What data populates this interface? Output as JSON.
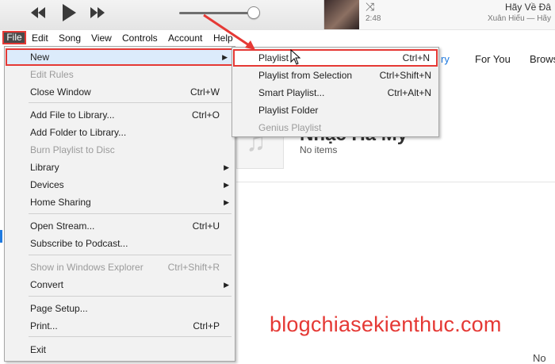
{
  "player": {
    "prev_icon": "rewind-icon",
    "play_icon": "play-icon",
    "next_icon": "fast-forward-icon",
    "volume_level": 0.9,
    "now_playing": {
      "title": "Hãy Về Đâ",
      "time": "2:48",
      "artist": "Xuân Hiếu — Hãy",
      "shuffle_icon": "shuffle-icon"
    }
  },
  "menubar": [
    "File",
    "Edit",
    "Song",
    "View",
    "Controls",
    "Account",
    "Help"
  ],
  "background": {
    "tab_partial": "ry",
    "tab_for_you": "For You",
    "tab_browse": "Brows",
    "playlist_title": "Nhạc Hà My",
    "playlist_sub": "No items",
    "corner_text": "No"
  },
  "file_menu": {
    "items": [
      {
        "label": "New",
        "shortcut": "",
        "submenu": true
      },
      {
        "label": "Edit Rules",
        "shortcut": "",
        "disabled": true
      },
      {
        "label": "Close Window",
        "shortcut": "Ctrl+W"
      },
      {
        "label": "Add File to Library...",
        "shortcut": "Ctrl+O"
      },
      {
        "label": "Add Folder to Library...",
        "shortcut": ""
      },
      {
        "label": "Burn Playlist to Disc",
        "shortcut": "",
        "disabled": true
      },
      {
        "label": "Library",
        "shortcut": "",
        "submenu": true
      },
      {
        "label": "Devices",
        "shortcut": "",
        "submenu": true
      },
      {
        "label": "Home Sharing",
        "shortcut": "",
        "submenu": true
      },
      {
        "label": "Open Stream...",
        "shortcut": "Ctrl+U"
      },
      {
        "label": "Subscribe to Podcast...",
        "shortcut": ""
      },
      {
        "label": "Show in Windows Explorer",
        "shortcut": "Ctrl+Shift+R",
        "disabled": true
      },
      {
        "label": "Convert",
        "shortcut": "",
        "submenu": true
      },
      {
        "label": "Page Setup...",
        "shortcut": ""
      },
      {
        "label": "Print...",
        "shortcut": "Ctrl+P"
      },
      {
        "label": "Exit",
        "shortcut": ""
      }
    ]
  },
  "new_submenu": {
    "items": [
      {
        "label": "Playlist",
        "shortcut": "Ctrl+N"
      },
      {
        "label": "Playlist from Selection",
        "shortcut": "Ctrl+Shift+N"
      },
      {
        "label": "Smart Playlist...",
        "shortcut": "Ctrl+Alt+N"
      },
      {
        "label": "Playlist Folder",
        "shortcut": ""
      },
      {
        "label": "Genius Playlist",
        "shortcut": "",
        "disabled": true
      }
    ]
  },
  "watermark": "blogchiasekienthuc.com",
  "colors": {
    "highlight_border": "#e53935",
    "accent": "#1f7ae0"
  }
}
